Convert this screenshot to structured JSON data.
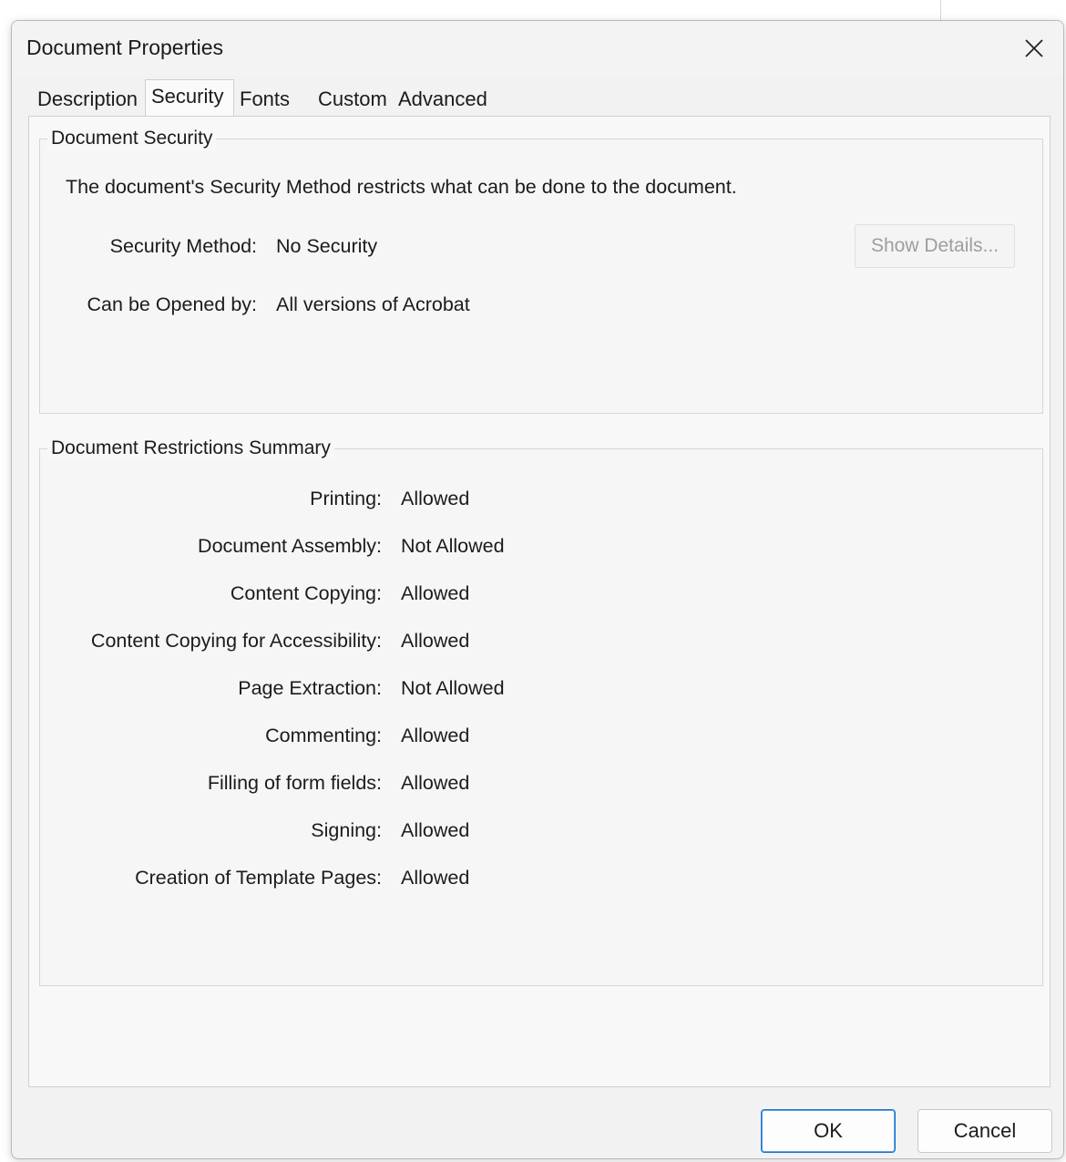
{
  "window": {
    "title": "Document Properties",
    "close_icon": "close-icon"
  },
  "tabs": [
    {
      "label": "Description",
      "active": false
    },
    {
      "label": "Security",
      "active": true
    },
    {
      "label": "Fonts",
      "active": false
    },
    {
      "label": "Custom",
      "active": false
    },
    {
      "label": "Advanced",
      "active": false
    }
  ],
  "security": {
    "group_title": "Document Security",
    "description": "The document's Security Method restricts what can be done to the document.",
    "method_label": "Security Method:",
    "method_value": "No Security",
    "opened_by_label": "Can be Opened by:",
    "opened_by_value": "All versions of Acrobat",
    "show_details_label": "Show Details..."
  },
  "restrictions": {
    "group_title": "Document Restrictions Summary",
    "items": [
      {
        "label": "Printing:",
        "value": "Allowed"
      },
      {
        "label": "Document Assembly:",
        "value": "Not Allowed"
      },
      {
        "label": "Content Copying:",
        "value": "Allowed"
      },
      {
        "label": "Content Copying for Accessibility:",
        "value": "Allowed"
      },
      {
        "label": "Page Extraction:",
        "value": "Not Allowed"
      },
      {
        "label": "Commenting:",
        "value": "Allowed"
      },
      {
        "label": "Filling of form fields:",
        "value": "Allowed"
      },
      {
        "label": "Signing:",
        "value": "Allowed"
      },
      {
        "label": "Creation of Template Pages:",
        "value": "Allowed"
      }
    ]
  },
  "footer": {
    "ok_label": "OK",
    "cancel_label": "Cancel"
  },
  "colors": {
    "dialog_bg": "#f2f2f2",
    "ok_border": "#1a73c8",
    "disabled_text": "#9e9e9e"
  }
}
